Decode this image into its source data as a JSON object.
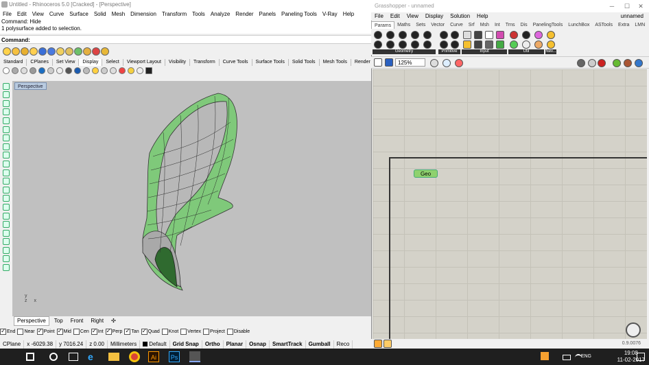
{
  "rhino": {
    "title": "Untitled - Rhinoceros 5.0 [Cracked] - [Perspective]",
    "menu": [
      "File",
      "Edit",
      "View",
      "Curve",
      "Surface",
      "Solid",
      "Mesh",
      "Dimension",
      "Transform",
      "Tools",
      "Analyze",
      "Render",
      "Panels",
      "Paneling Tools",
      "V-Ray",
      "Help"
    ],
    "history": [
      "Command: Hide",
      "1 polysurface added to selection."
    ],
    "command_prompt": "Command:",
    "tabs": [
      "Standard",
      "CPlanes",
      "Set View",
      "Display",
      "Select",
      "Viewport Layout",
      "Visibility",
      "Transform",
      "Curve Tools",
      "Surface Tools",
      "Solid Tools",
      "Mesh Tools",
      "Render Tools"
    ],
    "active_tab": "Display",
    "viewport_label": "Perspective",
    "viewport_tabs": [
      "Perspective",
      "Top",
      "Front",
      "Right",
      "✣"
    ],
    "osnaps": [
      {
        "label": "End",
        "on": true
      },
      {
        "label": "Near",
        "on": false
      },
      {
        "label": "Point",
        "on": true
      },
      {
        "label": "Mid",
        "on": true
      },
      {
        "label": "Cen",
        "on": false
      },
      {
        "label": "Int",
        "on": true
      },
      {
        "label": "Perp",
        "on": true
      },
      {
        "label": "Tan",
        "on": true
      },
      {
        "label": "Quad",
        "on": true
      },
      {
        "label": "Knot",
        "on": false
      },
      {
        "label": "Vertex",
        "on": false
      },
      {
        "label": "Project",
        "on": false
      },
      {
        "label": "Disable",
        "on": false
      }
    ],
    "status": {
      "cplane": "CPlane",
      "x": "x -6029.38",
      "y": "y 7016.24",
      "z": "z 0.00",
      "units": "Millimeters",
      "layer": "Default",
      "toggles": [
        "Grid Snap",
        "Ortho",
        "Planar",
        "Osnap",
        "SmartTrack",
        "Gumball",
        "Reco"
      ]
    },
    "axis": {
      "y": "y",
      "x": "x",
      "z": "z"
    }
  },
  "grasshopper": {
    "title": "Grasshopper - unnamed",
    "doc_name": "unnamed",
    "menu": [
      "File",
      "Edit",
      "View",
      "Display",
      "Solution",
      "Help"
    ],
    "tabs": [
      "Params",
      "Maths",
      "Sets",
      "Vector",
      "Curve",
      "Srf",
      "Msh",
      "Int",
      "Trns",
      "Dis",
      "PanelingTools",
      "LunchBox",
      "ASTools",
      "Extra",
      "LMN"
    ],
    "active_tab": "Params",
    "groups": [
      "Geometry",
      "Primitive",
      "Input",
      "Util",
      "Nev..."
    ],
    "zoom": "125%",
    "component": "Geo",
    "version": "0.9.0076"
  },
  "taskbar": {
    "language": "ENG",
    "time": "19:08",
    "date": "11-02-2017",
    "apps": [
      "windows-start",
      "search",
      "task-view",
      "edge",
      "file-explorer",
      "chrome",
      "illustrator",
      "photoshop",
      "rhino"
    ],
    "ai_label": "Ai",
    "ps_label": "Ps"
  },
  "colors": {
    "surface_green": "#6fc46a",
    "taskbar": "#1f1f1f",
    "geo_green": "#8fd16e"
  }
}
